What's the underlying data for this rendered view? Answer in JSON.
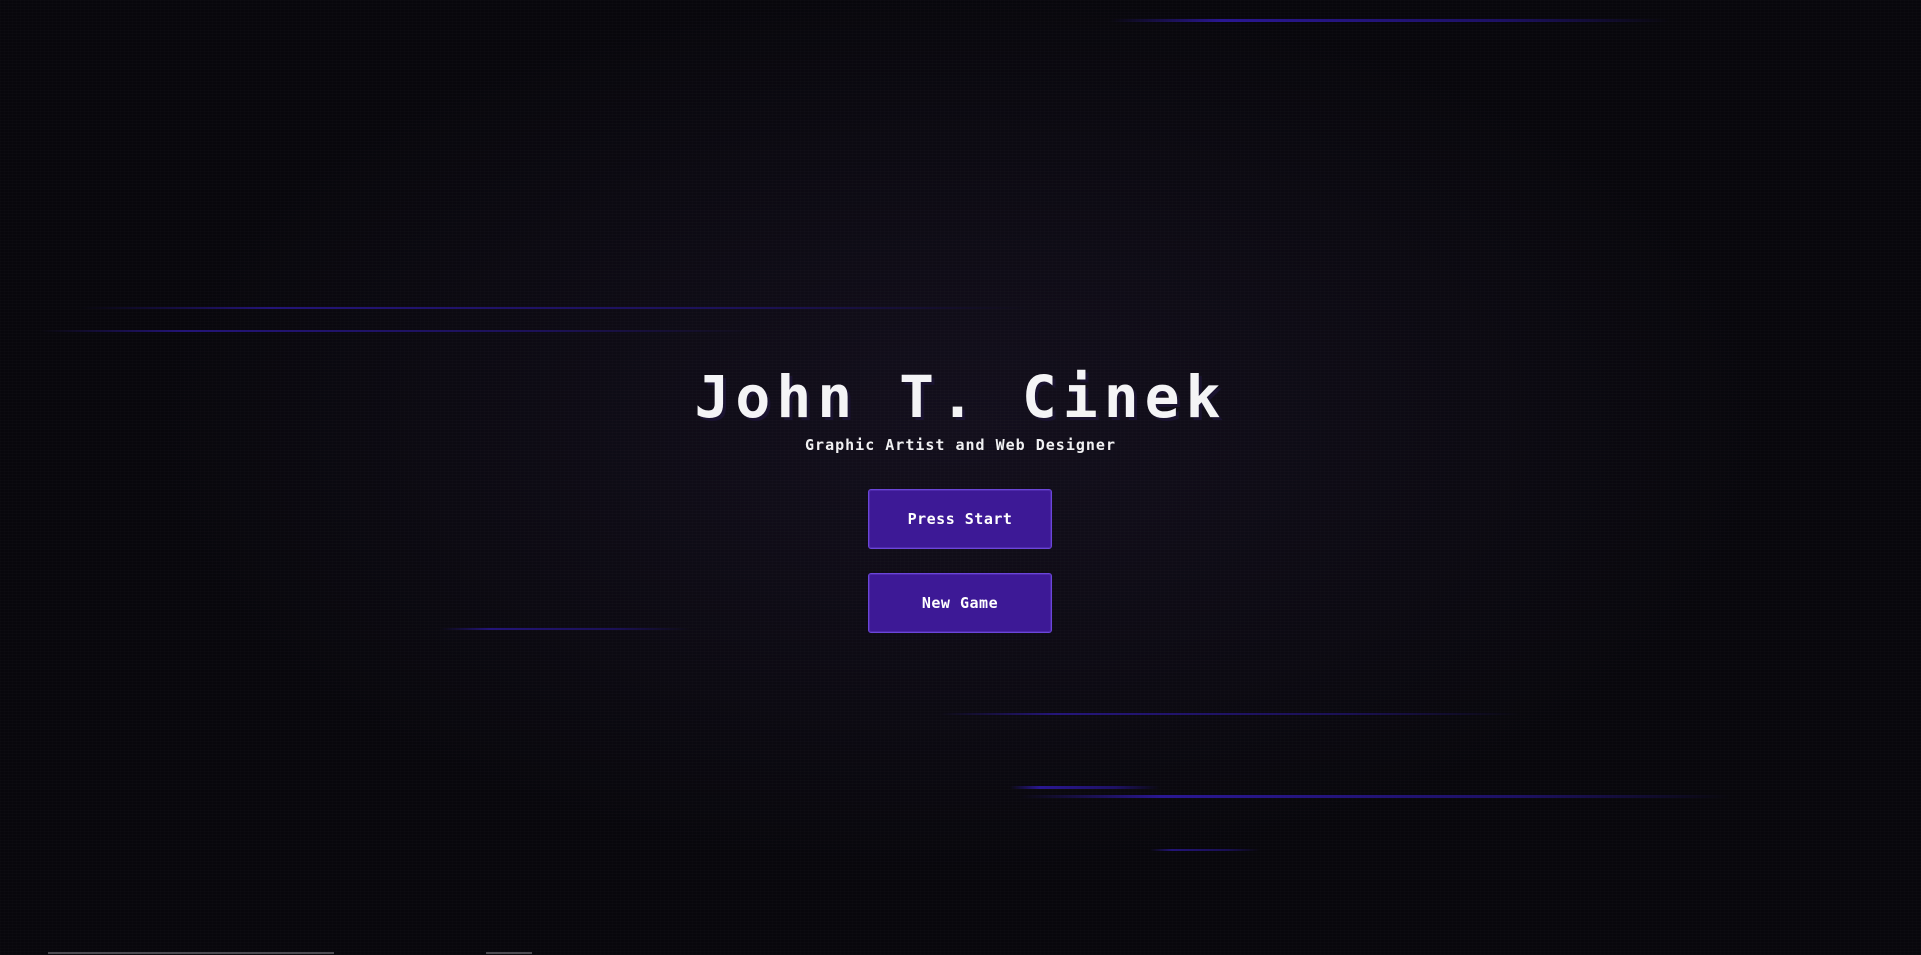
{
  "hero": {
    "name": "John T. Cinek",
    "tagline": "Graphic Artist and Web Designer"
  },
  "menu": {
    "start_label": "Press Start",
    "new_game_label": "New Game"
  },
  "colors": {
    "background": "#08070c",
    "button_fill": "#3d1996",
    "button_border": "#6b46d9",
    "glitch_line": "#341cbe",
    "text": "#f4f4f6"
  }
}
